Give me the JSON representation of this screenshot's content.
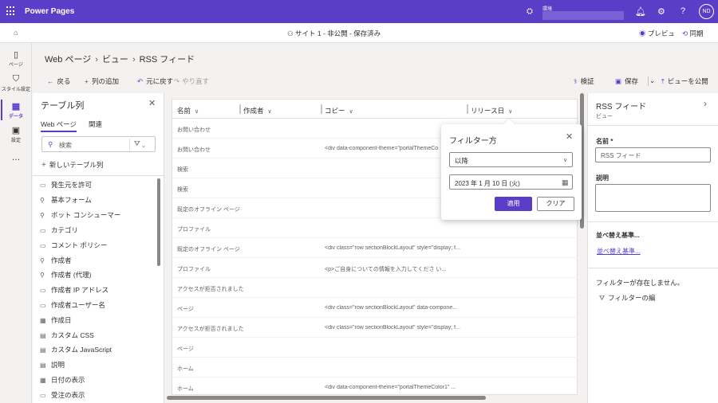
{
  "app": {
    "title": "Power Pages",
    "env_label": "環境",
    "avatar": "ND"
  },
  "topbar_icons": [
    "bell-icon",
    "gear-icon",
    "help-icon"
  ],
  "cmdbar": {
    "site_status": "サイト 1 - 非公開 - 保存済み",
    "preview": "プレビュ",
    "sync": "同期"
  },
  "leftnav": [
    {
      "label": "ページ",
      "icon": "page-icon"
    },
    {
      "label": "スタイル設定",
      "icon": "style-icon"
    },
    {
      "label": "データ",
      "icon": "data-icon"
    },
    {
      "label": "設定",
      "icon": "setup-icon"
    },
    {
      "label": "…",
      "icon": "more-icon"
    }
  ],
  "breadcrumb": [
    "Web ページ",
    "ビュー",
    "RSS フィード"
  ],
  "toolbar": {
    "back": "戻る",
    "add_column": "列の追加",
    "undo": "元に戻す",
    "redo": "やり直す",
    "validate": "検証",
    "save": "保存",
    "publish": "ビューを公開"
  },
  "panel": {
    "title": "テーブル列",
    "tabs": [
      "Web ページ",
      "関連"
    ],
    "search_placeholder": "検索",
    "new_column": "新しいテーブル列",
    "fields": [
      {
        "label": "発生元を許可",
        "icon": "▭"
      },
      {
        "label": "基本フォーム",
        "icon": "⚲"
      },
      {
        "label": "ボット コンシューマー",
        "icon": "⚲"
      },
      {
        "label": "カテゴリ",
        "icon": "▭"
      },
      {
        "label": "コメント ポリシー",
        "icon": "▭"
      },
      {
        "label": "作成者",
        "icon": "⚲"
      },
      {
        "label": "作成者 (代理)",
        "icon": "⚲"
      },
      {
        "label": "作成者 IP アドレス",
        "icon": "▭"
      },
      {
        "label": "作成者ユーザー名",
        "icon": "▭"
      },
      {
        "label": "作成日",
        "icon": "▦"
      },
      {
        "label": "カスタム CSS",
        "icon": "▤"
      },
      {
        "label": "カスタム JavaScript",
        "icon": "▤"
      },
      {
        "label": "説明",
        "icon": "▤"
      },
      {
        "label": "日付の表示",
        "icon": "▦"
      },
      {
        "label": "受注の表示",
        "icon": "▭"
      }
    ]
  },
  "grid": {
    "headers": [
      "名前",
      "作成者",
      "コピー",
      "リリース日"
    ],
    "rows": [
      {
        "name": "お問い合わせ",
        "copy": ""
      },
      {
        "name": "お問い合わせ",
        "copy": "<div data-component-theme=\"portalThemeCo"
      },
      {
        "name": "検索",
        "copy": ""
      },
      {
        "name": "検索",
        "copy": ""
      },
      {
        "name": "既定のオフライン ページ",
        "copy": ""
      },
      {
        "name": "プロファイル",
        "copy": ""
      },
      {
        "name": "既定のオフライン ページ",
        "copy": "<div class=\"row sectionBlockLayout\" style=\"display; f..."
      },
      {
        "name": "プロファイル",
        "copy": "<p>ご自身についての情報を入力してくださ い..."
      },
      {
        "name": "アクセスが拒否されました",
        "copy": ""
      },
      {
        "name": "ページ",
        "copy": "<div class=\"row sectionBlockLayout\" data-compone..."
      },
      {
        "name": "アクセスが拒否されました",
        "copy": "<div class=\"row sectionBlockLayout\" style=\"display; f..."
      },
      {
        "name": "ページ",
        "copy": ""
      },
      {
        "name": "ホーム",
        "copy": ""
      },
      {
        "name": "ホーム",
        "copy": "<div data-component-theme=\"portalThemeColor1\" ..."
      }
    ]
  },
  "filter_popup": {
    "title": "フィルター方",
    "operator": "以降",
    "date": "2023 年 1 月 10 日 (火)",
    "apply": "適用",
    "clear": "クリア"
  },
  "rpanel": {
    "title": "RSS フィード",
    "subtitle": "ビュー",
    "name_label": "名前 *",
    "name_value": "RSS フィード",
    "desc_label": "説明",
    "sort_label": "並べ替え基準...",
    "sort_link": "並べ替え基準...",
    "no_filter": "フィルターが存在しません。",
    "edit_filter": "フィルターの編"
  },
  "colors": {
    "accent": "#5a3ec8"
  }
}
